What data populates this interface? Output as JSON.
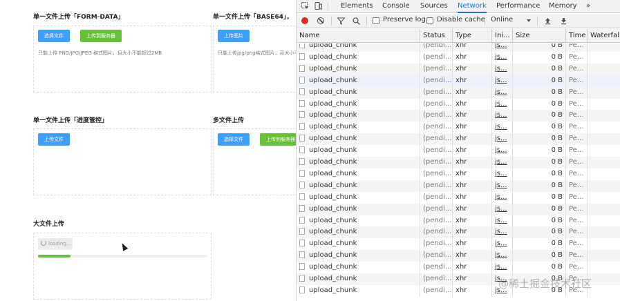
{
  "upload_page": {
    "sections": [
      {
        "title": "单一文件上传「FORM-DATA」",
        "buttons": [
          "选择文件",
          "上传到服务器"
        ],
        "tip": "只能上传 PNG/JPG/JPEG 格式图片，且大小不能超过2MB"
      },
      {
        "title": "单一文件上传「BASE64」，",
        "buttons": [
          "上传图片"
        ],
        "tip": "只能上传jpg/png格式图片，且大小不能超过"
      },
      {
        "title": "单一文件上传「进度管控」",
        "buttons": [
          "上传文件"
        ]
      },
      {
        "title": "多文件上传",
        "buttons": [
          "选择文件",
          "上传到服务器"
        ]
      },
      {
        "title": "大文件上传",
        "loading_label": "loading..."
      }
    ],
    "big_file_progress": 0.19
  },
  "devtools": {
    "tabs": [
      "Elements",
      "Console",
      "Sources",
      "Network",
      "Performance",
      "Memory"
    ],
    "active_tab": "Network",
    "more_tabs": "»",
    "toolbar": {
      "preserve_log": "Preserve log",
      "disable_cache": "Disable cache",
      "throttling": "Online"
    },
    "columns": [
      "Name",
      "Status",
      "Type",
      "Ini...",
      "Size",
      "Time",
      "Waterfall"
    ],
    "rows": [
      {
        "name": "upload_chunk",
        "status": "(pendi...",
        "type": "xhr",
        "initiator": "js...",
        "size": "0 B",
        "time": "Pe..."
      },
      {
        "name": "upload_chunk",
        "status": "(pendi...",
        "type": "xhr",
        "initiator": "js...",
        "size": "0 B",
        "time": "Pe..."
      },
      {
        "name": "upload_chunk",
        "status": "(pendi...",
        "type": "xhr",
        "initiator": "js...",
        "size": "0 B",
        "time": "Pe..."
      },
      {
        "name": "upload_chunk",
        "status": "(pendi...",
        "type": "xhr",
        "initiator": "js...",
        "size": "0 B",
        "time": "Pe..."
      },
      {
        "name": "upload_chunk",
        "status": "(pendi...",
        "type": "xhr",
        "initiator": "js...",
        "size": "0 B",
        "time": "Pe..."
      },
      {
        "name": "upload_chunk",
        "status": "(pendi...",
        "type": "xhr",
        "initiator": "js...",
        "size": "0 B",
        "time": "Pe..."
      },
      {
        "name": "upload_chunk",
        "status": "(pendi...",
        "type": "xhr",
        "initiator": "js...",
        "size": "0 B",
        "time": "Pe..."
      },
      {
        "name": "upload_chunk",
        "status": "(pendi...",
        "type": "xhr",
        "initiator": "js...",
        "size": "0 B",
        "time": "Pe..."
      },
      {
        "name": "upload_chunk",
        "status": "(pendi...",
        "type": "xhr",
        "initiator": "js...",
        "size": "0 B",
        "time": "Pe..."
      },
      {
        "name": "upload_chunk",
        "status": "(pendi...",
        "type": "xhr",
        "initiator": "js...",
        "size": "0 B",
        "time": "Pe..."
      },
      {
        "name": "upload_chunk",
        "status": "(pendi...",
        "type": "xhr",
        "initiator": "js...",
        "size": "0 B",
        "time": "Pe..."
      },
      {
        "name": "upload_chunk",
        "status": "(pendi...",
        "type": "xhr",
        "initiator": "js...",
        "size": "0 B",
        "time": "Pe..."
      },
      {
        "name": "upload_chunk",
        "status": "(pendi...",
        "type": "xhr",
        "initiator": "js...",
        "size": "0 B",
        "time": "Pe..."
      },
      {
        "name": "upload_chunk",
        "status": "(pendi...",
        "type": "xhr",
        "initiator": "js...",
        "size": "0 B",
        "time": "Pe..."
      },
      {
        "name": "upload_chunk",
        "status": "(pendi...",
        "type": "xhr",
        "initiator": "js...",
        "size": "0 B",
        "time": "Pe..."
      },
      {
        "name": "upload_chunk",
        "status": "(pendi...",
        "type": "xhr",
        "initiator": "js...",
        "size": "0 B",
        "time": "Pe..."
      },
      {
        "name": "upload_chunk",
        "status": "(pendi...",
        "type": "xhr",
        "initiator": "js...",
        "size": "0 B",
        "time": "Pe..."
      },
      {
        "name": "upload_chunk",
        "status": "(pendi...",
        "type": "xhr",
        "initiator": "js...",
        "size": "0 B",
        "time": "Pe..."
      },
      {
        "name": "upload_chunk",
        "status": "(pendi...",
        "type": "xhr",
        "initiator": "js...",
        "size": "0 B",
        "time": "Pe..."
      },
      {
        "name": "upload_chunk",
        "status": "(pendi...",
        "type": "xhr",
        "initiator": "js...",
        "size": "0 B",
        "time": "Pe..."
      },
      {
        "name": "upload_chunk",
        "status": "(pendi...",
        "type": "xhr",
        "initiator": "js...",
        "size": "0 B",
        "time": "Pe..."
      },
      {
        "name": "upload_chunk",
        "status": "(pendi...",
        "type": "xhr",
        "initiator": "js...",
        "size": "0 B",
        "time": "Pe..."
      }
    ],
    "row_icon": "file-icon",
    "record_color": "#d93025",
    "accent_color": "#1a73e8"
  },
  "watermark": "@稀土掘金技术社区"
}
